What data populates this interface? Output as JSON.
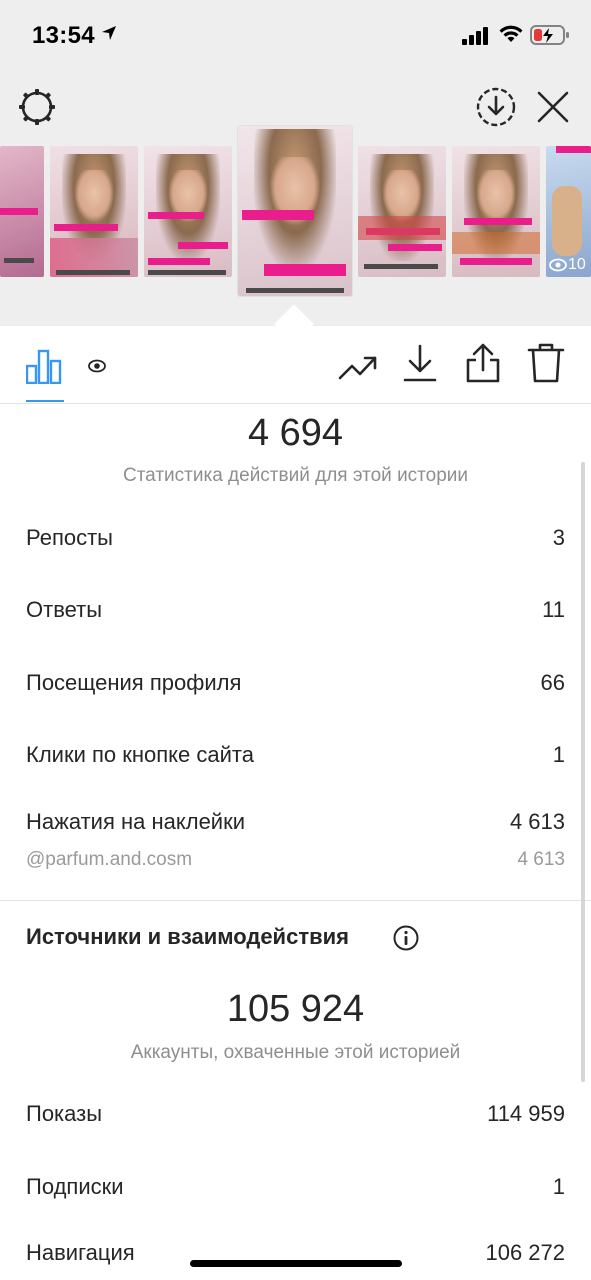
{
  "status_bar": {
    "time": "13:54"
  },
  "thumbnails": [
    {
      "id": "t1",
      "bg": "#c9a2b6",
      "views": ""
    },
    {
      "id": "t2",
      "bg": "#d9b7b8",
      "views": ""
    },
    {
      "id": "t3",
      "bg": "#d8bfc6",
      "views": ""
    },
    {
      "id": "t4",
      "bg": "#cdb3c4",
      "views": "",
      "active": true,
      "sticker": "@parfum.and.cosm"
    },
    {
      "id": "t5",
      "bg": "#d6c0c7",
      "views": ""
    },
    {
      "id": "t6",
      "bg": "#d9c3c6",
      "views": ""
    },
    {
      "id": "t7",
      "bg": "#9fb8d6",
      "views": "10"
    }
  ],
  "stats": {
    "interactions_total": "4 694",
    "interactions_caption": "Статистика действий для этой истории",
    "rows": [
      {
        "label": "Репосты",
        "value": "3"
      },
      {
        "label": "Ответы",
        "value": "11"
      },
      {
        "label": "Посещения профиля",
        "value": "66"
      },
      {
        "label": "Клики по кнопке сайта",
        "value": "1"
      },
      {
        "label": "Нажатия на наклейки",
        "value": "4 613"
      }
    ],
    "sticker_sub": {
      "label": "@parfum.and.cosm",
      "value": "4 613"
    }
  },
  "discovery": {
    "title": "Источники и взаимодействия",
    "reach_total": "105 924",
    "reach_caption": "Аккаунты, охваченные этой историей",
    "rows": [
      {
        "label": "Показы",
        "value": "114 959"
      },
      {
        "label": "Подписки",
        "value": "1"
      },
      {
        "label": "Навигация",
        "value": "106 272"
      }
    ]
  },
  "colors": {
    "accent": "#3897f0",
    "sticker_pink": "#e91e8c"
  }
}
